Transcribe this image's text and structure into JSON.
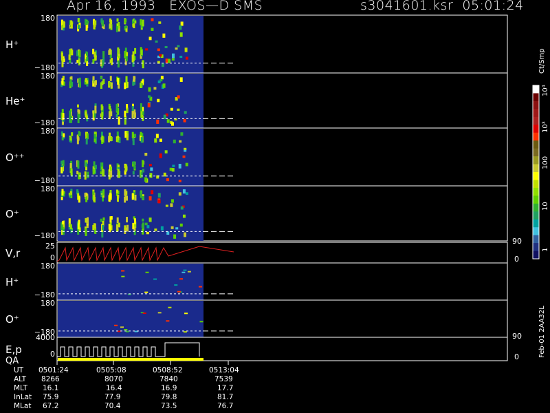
{
  "header": {
    "date_title": "Apr 16, 1993   EXOS—D SMS",
    "file_time": "s3041601.ksr  05:01:24"
  },
  "colorbar": {
    "title": "Ct/Smp",
    "tick_labels": [
      "10⁴",
      "10³",
      "100",
      "10",
      "1"
    ],
    "colors": [
      "#ffffff",
      "#6b0000",
      "#8b1010",
      "#a01818",
      "#b02020",
      "#e00000",
      "#ff3000",
      "#6b5a10",
      "#7a6a20",
      "#9a9a20",
      "#c8c830",
      "#ffff00",
      "#c0e000",
      "#90e000",
      "#60d000",
      "#30b030",
      "#20a060",
      "#00a0a0",
      "#40c0e0",
      "#3060a0",
      "#203080",
      "#101060"
    ]
  },
  "footer": {
    "rows": [
      {
        "label": "UT",
        "values": [
          "0501:24",
          "0505:08",
          "0508:52",
          "0513:04"
        ]
      },
      {
        "label": "ALT",
        "values": [
          "8266",
          "8070",
          "7840",
          "7539"
        ]
      },
      {
        "label": "MLT",
        "values": [
          "16.1",
          "16.4",
          "16.9",
          "17.7"
        ]
      },
      {
        "label": "InLat",
        "values": [
          "75.9",
          "77.9",
          "79.8",
          "81.7"
        ]
      },
      {
        "label": "MLat",
        "values": [
          "67.2",
          "70.4",
          "73.5",
          "76.7"
        ]
      }
    ],
    "side_note": "Feb-01 2AA32L"
  },
  "chart_data": {
    "type": "heatmap",
    "title": "Apr 16, 1993   EXOS—D SMS",
    "file": "s3041601.ksr",
    "start_time": "05:01:24",
    "x_tick_labels": [
      "0501:24",
      "0505:08",
      "0508:52",
      "0513:04"
    ],
    "panels": [
      {
        "label": "H⁺",
        "kind": "spectrogram",
        "ytop": "180",
        "ybottom": "−180",
        "yrange": [
          -180,
          180
        ]
      },
      {
        "label": "He⁺",
        "kind": "spectrogram",
        "ytop": "180",
        "ybottom": "−180",
        "yrange": [
          -180,
          180
        ]
      },
      {
        "label": "O⁺⁺",
        "kind": "spectrogram",
        "ytop": "180",
        "ybottom": "−180",
        "yrange": [
          -180,
          180
        ]
      },
      {
        "label": "O⁺",
        "kind": "spectrogram",
        "ytop": "180",
        "ybottom": "−180",
        "yrange": [
          -180,
          180
        ]
      },
      {
        "label": "V,r",
        "kind": "line",
        "ytop": "25",
        "ybottom": "0",
        "yrange": [
          0,
          25
        ],
        "right_top": "90",
        "right_bottom": "0"
      },
      {
        "label": "H⁺",
        "kind": "spectrogram",
        "ytop": "180",
        "ybottom": "−180",
        "yrange": [
          -180,
          180
        ]
      },
      {
        "label": "O⁺",
        "kind": "spectrogram",
        "ytop": "180",
        "ybottom": "−180",
        "yrange": [
          -180,
          180
        ]
      },
      {
        "label": "E,p",
        "label2": "QA",
        "kind": "line",
        "ytop": "4000",
        "ybottom": "0",
        "yrange": [
          0,
          4000
        ],
        "right_top": "90",
        "right_bottom": "0"
      }
    ]
  }
}
